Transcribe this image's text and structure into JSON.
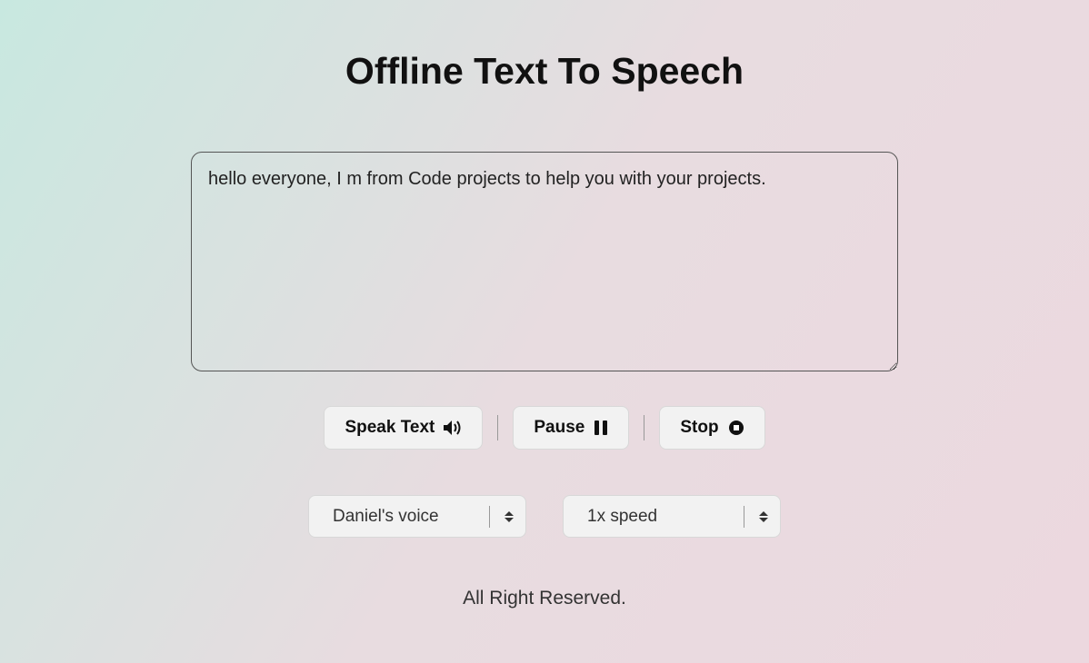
{
  "title": "Offline Text To Speech",
  "textarea": {
    "value": "hello everyone, I m from Code projects to help you with your projects."
  },
  "buttons": {
    "speak": "Speak Text",
    "pause": "Pause",
    "stop": "Stop"
  },
  "selects": {
    "voice": {
      "selected": "Daniel's voice"
    },
    "speed": {
      "selected": "1x speed"
    }
  },
  "footer": "All Right Reserved."
}
